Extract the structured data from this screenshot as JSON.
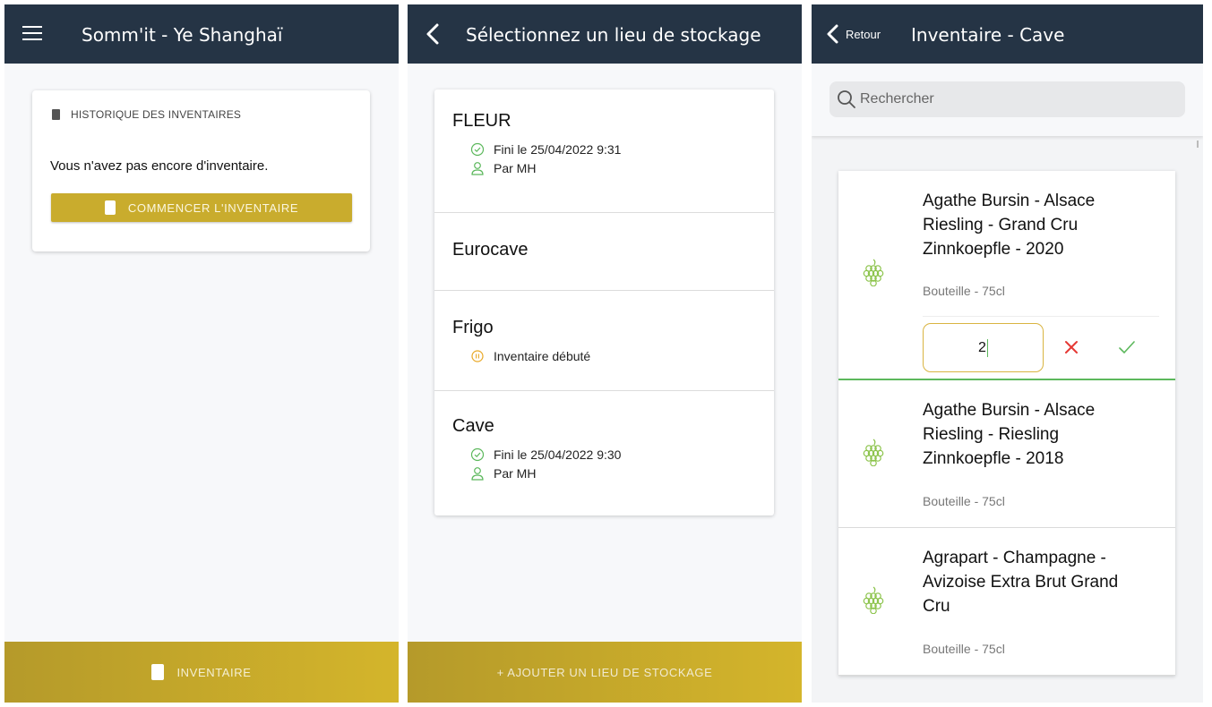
{
  "screen1": {
    "title": "Somm'it - Ye Shanghaï",
    "card_header": "HISTORIQUE DES INVENTAIRES",
    "empty_message": "Vous n'avez pas encore d'inventaire.",
    "start_button": "COMMENCER L'INVENTAIRE",
    "bottom_button": "INVENTAIRE"
  },
  "screen2": {
    "title": "Sélectionnez un lieu de stockage",
    "locations": [
      {
        "name": "FLEUR",
        "status": "Fini le 25/04/2022 9:31",
        "status_icon": "check-circle-icon",
        "user": "Par MH",
        "user_icon": "user-icon"
      },
      {
        "name": "Eurocave"
      },
      {
        "name": "Frigo",
        "status": "Inventaire débuté",
        "status_icon": "pause-circle-icon"
      },
      {
        "name": "Cave",
        "status": "Fini le 25/04/2022 9:30",
        "status_icon": "check-circle-icon",
        "user": "Par MH",
        "user_icon": "user-icon"
      }
    ],
    "add_button": "+ AJOUTER UN LIEU DE STOCKAGE"
  },
  "screen3": {
    "back_label": "Retour",
    "title": "Inventaire - Cave",
    "search_placeholder": "Rechercher",
    "items": [
      {
        "name": "Agathe Bursin - Alsace Riesling - Grand Cru Zinnkoepfle - 2020",
        "format": "Bouteille - 75cl",
        "quantity": "2",
        "icon": "grape-icon"
      },
      {
        "name": "Agathe Bursin - Alsace Riesling - Riesling Zinnkoepfle - 2018",
        "format": "Bouteille - 75cl",
        "icon": "grape-icon"
      },
      {
        "name": "Agrapart - Champagne - Avizoise Extra Brut Grand Cru",
        "format": "Bouteille - 75cl",
        "icon": "grape-icon"
      }
    ],
    "colors": {
      "header": "#253445",
      "accent_gold": "#c9ac2d",
      "success": "#5cb85c",
      "cancel": "#e53935"
    }
  }
}
